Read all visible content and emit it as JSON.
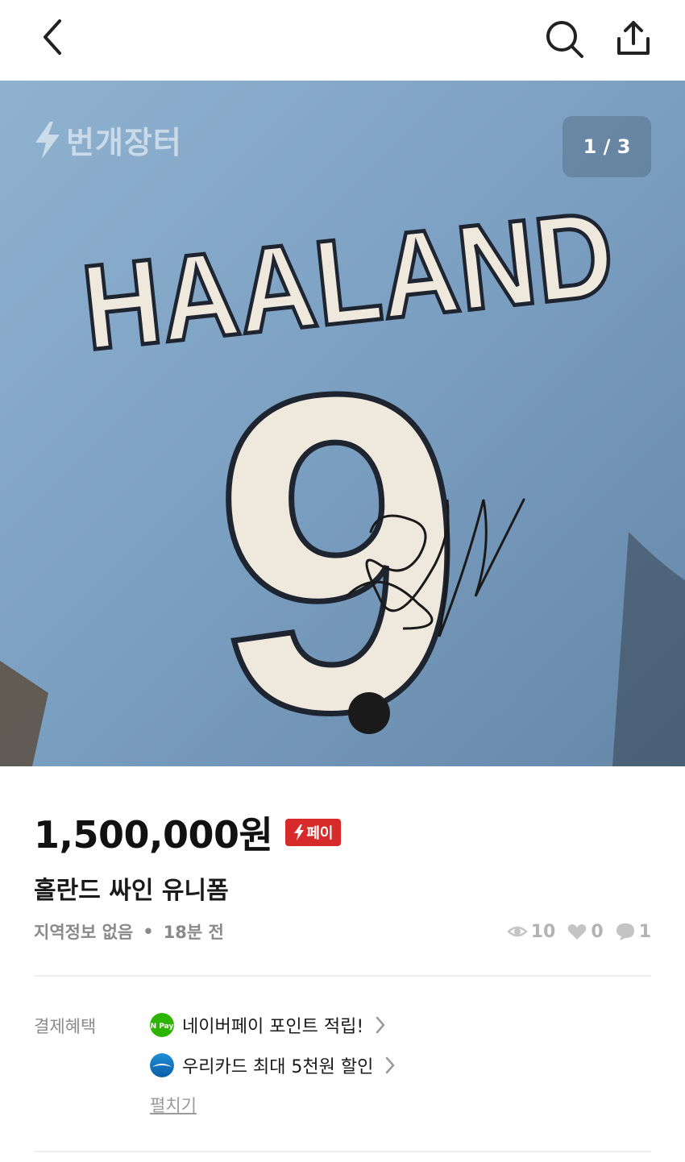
{
  "header": {
    "back_icon": "chevron-left-icon",
    "search_icon": "search-icon",
    "share_icon": "share-icon"
  },
  "gallery": {
    "watermark": "번개장터",
    "counter": "1 / 3",
    "jersey_name": "HAALAND",
    "jersey_number": "9"
  },
  "product": {
    "price": "1,500,000원",
    "pay_badge": "페이",
    "title": "홀란드 싸인 유니폼",
    "location": "지역정보 없음",
    "separator": "•",
    "time": "18분 전",
    "views": "10",
    "likes": "0",
    "chats": "1"
  },
  "benefits": {
    "label": "결제혜택",
    "items": [
      {
        "text": "네이버페이 포인트 적립!",
        "icon": "naver-pay-icon",
        "icon_text": "N Pay"
      },
      {
        "text": "우리카드 최대 5천원 할인",
        "icon": "woori-card-icon"
      }
    ],
    "expand": "펼치기"
  },
  "colors": {
    "pay_badge_bg": "#d72a2a",
    "jersey_blue": "#7a9fc0",
    "naver_green": "#2db400"
  }
}
